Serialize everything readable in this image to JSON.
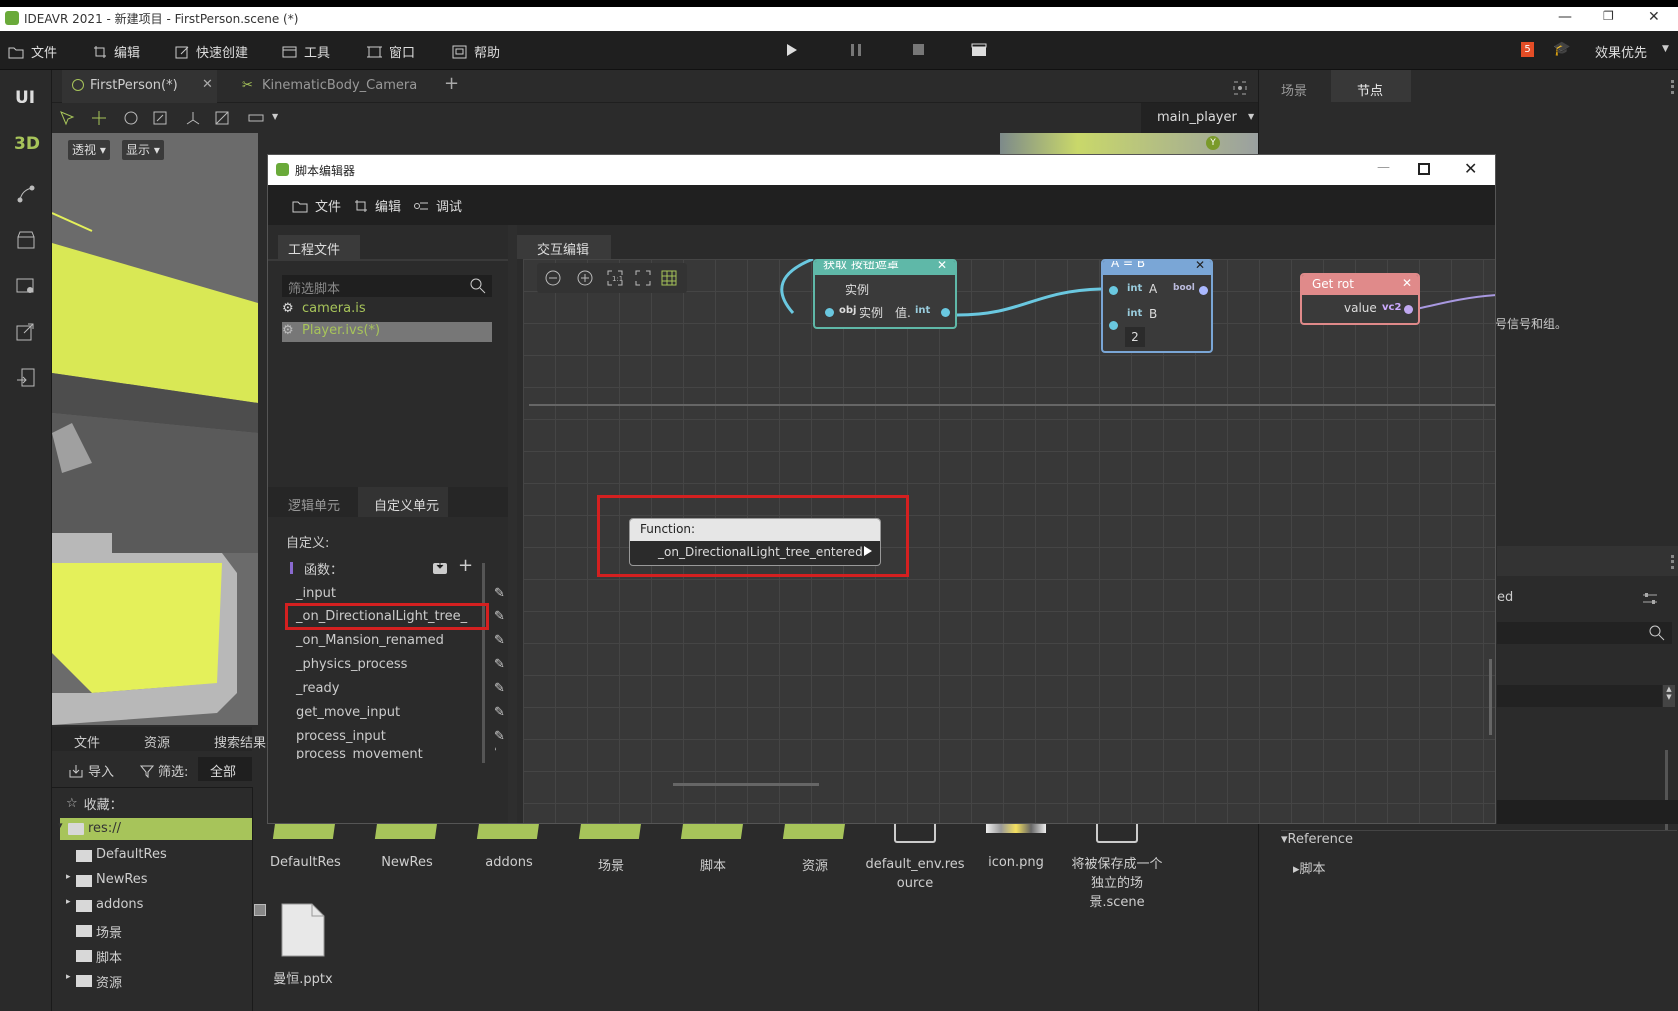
{
  "window": {
    "title": "IDEAVR 2021 - 新建项目 - FirstPerson.scene (*)"
  },
  "menubar": {
    "items": [
      "文件",
      "编辑",
      "快速创建",
      "工具",
      "窗口",
      "帮助"
    ],
    "quality": "效果优先"
  },
  "leftbar": {
    "ui": "UI",
    "3d": "3D"
  },
  "scene_tabs": {
    "tab1": "FirstPerson(*)",
    "tab2": "KinematicBody_Camera",
    "add": "+"
  },
  "viewport_toolbar": {
    "perspective": "透视",
    "display": "显示",
    "player_select": "main_player",
    "axis_y": "Y"
  },
  "right_panel": {
    "tab_scene": "场景",
    "tab_node": "节点",
    "info_text": "号信号和组。",
    "ed_text": "ed",
    "reference": "Reference",
    "script": "脚本"
  },
  "file_panel": {
    "tabs": [
      "文件",
      "资源",
      "搜索结果"
    ],
    "import": "导入",
    "filter_label": "筛选:",
    "filter_value": "全部",
    "favorites": "收藏：",
    "tree": [
      "res://",
      "DefaultRes",
      "NewRes",
      "addons",
      "场景",
      "脚本",
      "资源"
    ],
    "grid_items": [
      "DefaultRes",
      "NewRes",
      "addons",
      "场景",
      "脚本",
      "资源",
      "default_env.res ource",
      "icon.png",
      "将被保存成一个 独立的场景.scene"
    ],
    "file2": "曼恒.pptx"
  },
  "dialog": {
    "title": "脚本编辑器",
    "menu": [
      "文件",
      "编辑",
      "调试"
    ],
    "project_tab": "工程文件",
    "filter_placeholder": "筛选脚本",
    "scripts": [
      "camera.is",
      "Player.ivs(*)"
    ],
    "unit_tabs": [
      "逻辑单元",
      "自定义单元"
    ],
    "custom_label": "自定义:",
    "functions_label": "函数：",
    "functions": [
      "_input",
      "_on_DirectionalLight_tree_",
      "_on_Mansion_renamed",
      "_physics_process",
      "_ready",
      "get_move_input",
      "process_input",
      "process_movement"
    ],
    "editor_tab": "交互编辑",
    "node1": {
      "title": "获取 按钮遮罩",
      "row1": "实例",
      "row2_obj": "obj",
      "row2_label": "实例",
      "row2_val": "值.",
      "row2_type": "int"
    },
    "node2": {
      "title": "A = B",
      "a_type": "int",
      "a_label": "A",
      "out_type": "bool",
      "b_type": "int",
      "b_label": "B",
      "b_value": "2"
    },
    "node3": {
      "title": "Get rot",
      "label": "value",
      "type": "vc2"
    },
    "func_node": {
      "header": "Function:",
      "name": "_on_DirectionalLight_tree_entered"
    }
  },
  "colors": {
    "accent_green": "#a7c45a",
    "highlight_red": "#d42020",
    "node_teal": "#5fb8a8",
    "node_blue": "#7aa6d6",
    "node_red": "#e08a8a"
  }
}
